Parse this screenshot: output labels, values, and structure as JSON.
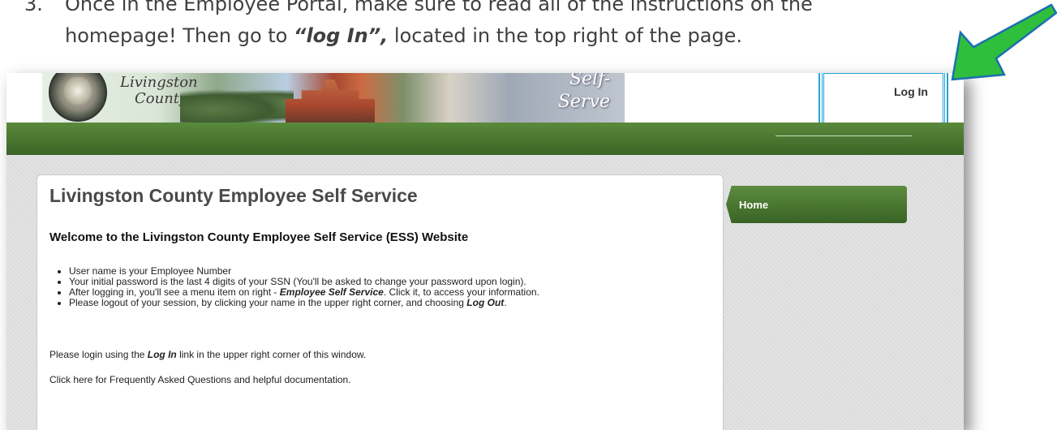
{
  "instruction": {
    "number": "3.",
    "line1": "Once in the Employee Portal, make sure to read all of the instructions on the",
    "line2_prefix": "homepage! Then go to ",
    "line2_emph": "“log In”,",
    "line2_suffix": " located in the top right of the page."
  },
  "header": {
    "brand_line1": "Livingston",
    "brand_line2": "County",
    "banner_line1": "Self-",
    "banner_line2": "Serve",
    "login_label": "Log In"
  },
  "main": {
    "title": "Livingston County Employee Self Service",
    "welcome": "Welcome to the Livingston County Employee Self Service (ESS) Website",
    "bullets": [
      {
        "text": "User name is your Employee Number"
      },
      {
        "text": "Your initial password is the last 4 digits of your SSN (You'll be asked to change your password upon login)."
      },
      {
        "pre": "After logging in, you'll see a menu item on right - ",
        "emph": "Employee Self Service",
        "post": ". Click it, to access your information."
      },
      {
        "pre": "Please logout of your session, by clicking your name in the upper right corner, and choosing ",
        "emph": "Log Out",
        "post": "."
      }
    ],
    "login_note_pre": "Please login using the ",
    "login_note_emph": "Log In",
    "login_note_post": " link in the upper right corner of this window.",
    "faq_text": "Click here for Frequently Asked Questions and helpful documentation."
  },
  "sidebar": {
    "home_label": "Home"
  },
  "colors": {
    "accent_green": "#48752f",
    "highlight_blue": "#23a3d6",
    "arrow_green": "#2fbf3c"
  }
}
